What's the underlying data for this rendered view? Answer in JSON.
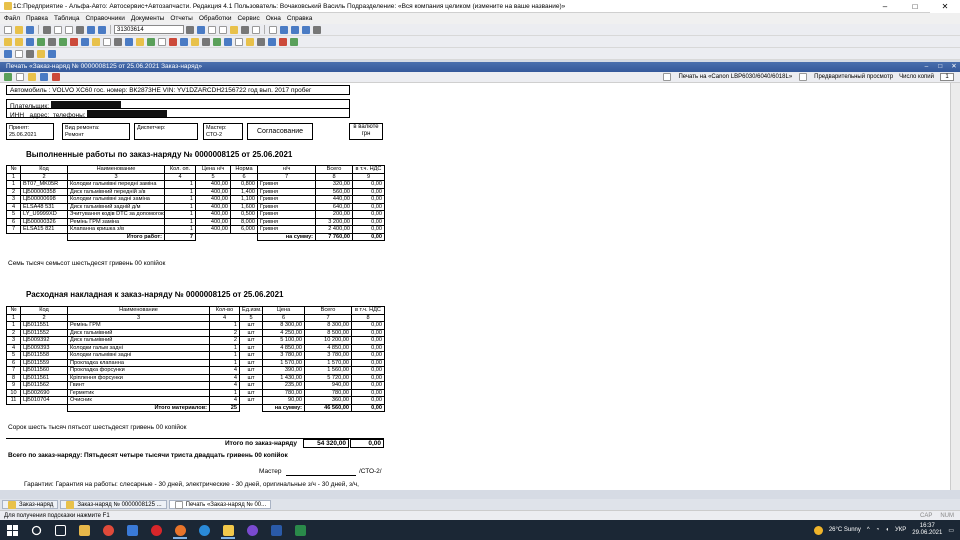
{
  "window": {
    "title": "1С:Предприятие - Альфа-Авто: Автосервис+Автозапчасти. Редакция 4.1    Пользователь: Вочаковський Василь    Подразделение: «Вся компания целиком (измените на ваше название)»",
    "minimize": "–",
    "maximize": "□",
    "close": "✕"
  },
  "menu": [
    "Файл",
    "Правка",
    "Таблица",
    "Справочники",
    "Документы",
    "Отчеты",
    "Обработки",
    "Сервис",
    "Окна",
    "Справка"
  ],
  "toolbar": {
    "search_value": "31303614"
  },
  "doc_window": {
    "title": "Печать «Заказ-наряд № 0000008125 от 25.06.2021 Заказ-наряд»",
    "controls": [
      "–",
      "□",
      "✕"
    ]
  },
  "printbar": {
    "print_label": "Печать на «Canon LBP6030/6040/6018L»",
    "preview_label": "Предварительный просмотр",
    "copies_label": "Число копий",
    "copies_value": "1"
  },
  "document": {
    "car": "Автомобиль : VOLVO XC60  гос. номер:  ВК2873НЕ    VIN: YV1DZARCDH2156722 год вып. 2017 пробег",
    "payer_label": "Плательщик:",
    "inn_label": "ИНН",
    "address_label": "адрес:",
    "phones_label": "телефоны:",
    "accepted_label": "Принят:",
    "accepted_value": "25.06.2021",
    "repair_type_label": "Вид ремонта:",
    "repair_type_value": "Ремонт",
    "dispatcher_label": "Диспетчер:",
    "dispatcher_value": "",
    "master_label": "Мастер:",
    "master_value": "СТО-2",
    "approval_label": "Согласование",
    "currency_label": "в валюте",
    "currency_value": "грн",
    "works_title": "Выполненные работы по заказ-наряду №  0000008125 от 25.06.2021",
    "works_headers": [
      "№",
      "Код",
      "Наименование",
      "Кол. оп.",
      "Цена н/ч",
      "Норма",
      "н/ч",
      "Всего",
      "в т.ч. НДС"
    ],
    "works_numbers": [
      "1",
      "2",
      "3",
      "4",
      "5",
      "6",
      "7",
      "8",
      "9"
    ],
    "works_rows": [
      [
        "1",
        "BT07_MK05R",
        "Колодки гальмівні передні заміна",
        "1",
        "400,00",
        "0,800",
        "Гривня",
        "320,00",
        "0,00"
      ],
      [
        "2",
        "ЦБ00000358",
        "Диск гальмівний передній з/в",
        "1",
        "400,00",
        "1,400",
        "Гривня",
        "560,00",
        "0,00"
      ],
      [
        "3",
        "ЦБ00000698",
        "Колодки гальмівні задні заміна",
        "1",
        "400,00",
        "1,100",
        "Гривня",
        "440,00",
        "0,00"
      ],
      [
        "4",
        "ELSA48 531",
        "Диск гальмівний задній д/м",
        "1",
        "400,00",
        "1,600",
        "Гривня",
        "640,00",
        "0,00"
      ],
      [
        "5",
        "LY_U9999XD",
        "Зчитування кодів DTC за допомогою NGS/WDS/MMDS тес",
        "1",
        "400,00",
        "0,500",
        "Гривня",
        "200,00",
        "0,00"
      ],
      [
        "6",
        "ЦБ00000326",
        "Ремінь ГРМ заміна",
        "1",
        "400,00",
        "8,000",
        "Гривня",
        "3 200,00",
        "0,00"
      ],
      [
        "7",
        "ELSA15 821",
        "Клапанна кришка з/в",
        "1",
        "400,00",
        "6,000",
        "Гривня",
        "2 400,00",
        "0,00"
      ]
    ],
    "works_total_label": "Итого работ:",
    "works_total_qty": "7",
    "works_sum_label": "на сумму:",
    "works_total_sum": "7 760,00",
    "works_total_vat": "0,00",
    "works_words": "Семь тысяч семьсот шестьдесят гривень 00 копійок",
    "parts_title": "Расходная накладная к заказ-наряду №  0000008125 от 25.06.2021",
    "parts_headers": [
      "№",
      "Код",
      "Наименование",
      "Кол-во",
      "Ед.изм.",
      "Цена",
      "Всего",
      "в т.ч. НДС"
    ],
    "parts_numbers": [
      "1",
      "2",
      "3",
      "4",
      "5",
      "6",
      "7",
      "8"
    ],
    "parts_rows": [
      [
        "1",
        "ЦБ011551",
        "Ремінь ГРМ",
        "1",
        "шт",
        "8 300,00",
        "8 300,00",
        "0,00"
      ],
      [
        "2",
        "ЦБ011552",
        "Диск гальмівний",
        "2",
        "шт",
        "4 250,00",
        "8 500,00",
        "0,00"
      ],
      [
        "3",
        "ЦБ009392",
        "Диск гальмівний",
        "2",
        "шт",
        "5 100,00",
        "10 200,00",
        "0,00"
      ],
      [
        "4",
        "ЦБ009393",
        "Колодки гальм задні",
        "1",
        "шт",
        "4 850,00",
        "4 850,00",
        "0,00"
      ],
      [
        "5",
        "ЦБ011558",
        "Колодки гальмівні задні",
        "1",
        "шт",
        "3 780,00",
        "3 780,00",
        "0,00"
      ],
      [
        "6",
        "ЦБ011559",
        "Прокладка клапанна",
        "1",
        "шт",
        "1 570,00",
        "1 570,00",
        "0,00"
      ],
      [
        "7",
        "ЦБ011560",
        "Прокладка форсунки",
        "4",
        "шт",
        "390,00",
        "1 560,00",
        "0,00"
      ],
      [
        "8",
        "ЦБ011561",
        "Кріплення форсунки",
        "4",
        "шт",
        "1 430,00",
        "5 720,00",
        "0,00"
      ],
      [
        "9",
        "ЦБ011562",
        "Гвинт",
        "4",
        "шт",
        "235,00",
        "940,00",
        "0,00"
      ],
      [
        "10",
        "ЦБ002690",
        "Герметик",
        "1",
        "шт",
        "780,00",
        "780,00",
        "0,00"
      ],
      [
        "11",
        "ЦБ010704",
        "Очисник",
        "4",
        "шт",
        "90,00",
        "360,00",
        "0,00"
      ]
    ],
    "parts_total_label": "Итого материалов:",
    "parts_total_qty": "25",
    "parts_sum_label": "на сумму:",
    "parts_total_sum": "46 560,00",
    "parts_total_vat": "0,00",
    "parts_words": "Сорок шесть тысяч пятьсот шестьдесят гривень 00 копійок",
    "grand_total_label": "Итого по заказ-наряду",
    "grand_total_sum": "54 320,00",
    "grand_total_vat": "0,00",
    "grand_words": "Всего по заказ-наряду: Пятьдесят четыре тысячи триста двадцать гривень 00 копійок",
    "master_sign_label": "Мастер",
    "master_sign_value": "/СТО-2/",
    "warranty": "Гарантии: Гарантия на работы: слесарные - 30 дней, электрические - 30 дней, оригинальные з/ч - 30 дней, з/ч,"
  },
  "tabs": [
    {
      "label": "Заказ-наряд"
    },
    {
      "label": "Заказ-наряд № 0000008125 ..."
    },
    {
      "label": "Печать «Заказ-наряд № 00..."
    }
  ],
  "status": {
    "hint": "Для получения подсказки нажмите F1",
    "cap": "CAP",
    "num": "NUM"
  },
  "taskbar": {
    "weather": "26°C  Sunny",
    "lang": "УКР",
    "time": "16:37",
    "date": "29.06.2021"
  }
}
